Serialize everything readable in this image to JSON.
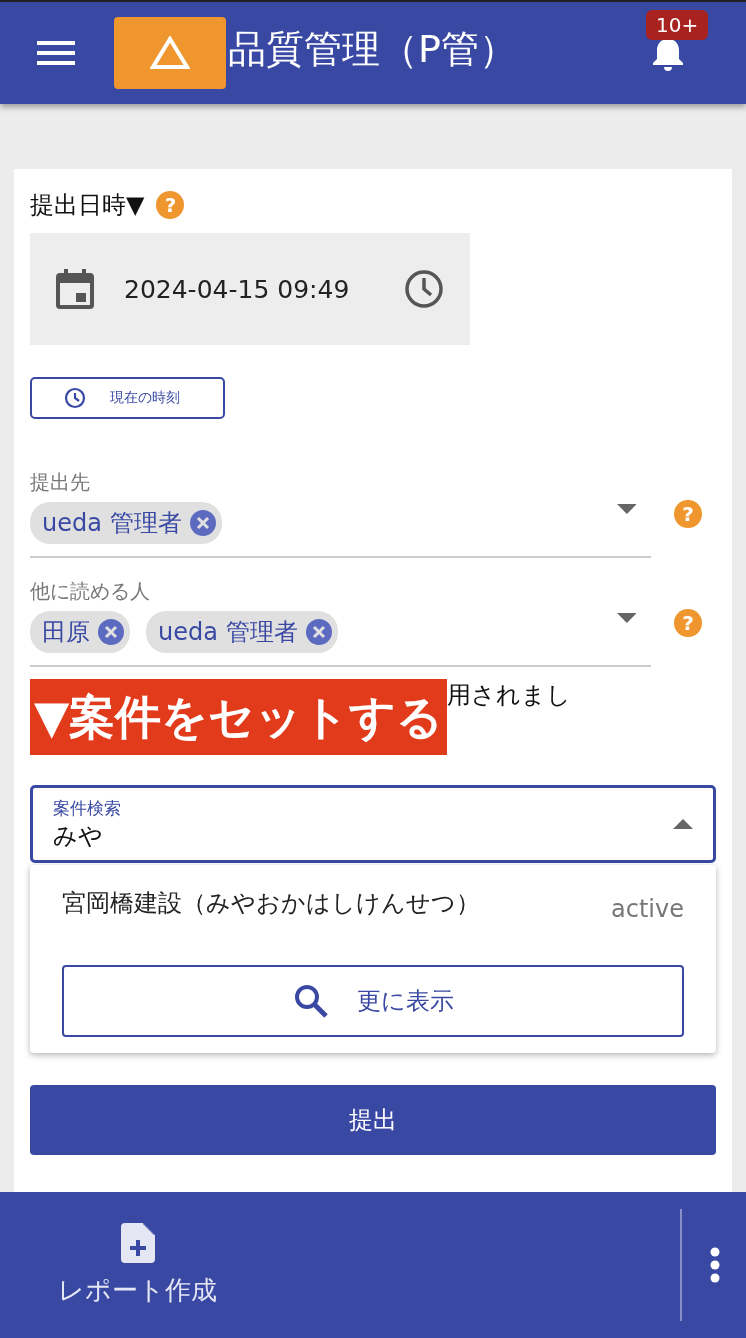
{
  "header": {
    "title": "品質管理（P管）",
    "badge": "10+"
  },
  "submit_time": {
    "label": "提出日時▼",
    "help": "?",
    "value": "2024-04-15 09:49",
    "now_button": "現在の時刻"
  },
  "recipients": {
    "label": "提出先",
    "help": "?",
    "chips": [
      "ueda 管理者"
    ]
  },
  "readers": {
    "label": "他に読める人",
    "help": "?",
    "chips": [
      "田原",
      "ueda 管理者"
    ]
  },
  "note": "用されまし",
  "banner": "▼案件をセットする",
  "case_search": {
    "label": "案件検索",
    "value": "みや",
    "expanded": true
  },
  "results": [
    {
      "name": "宮岡橋建設（みやおかはしけんせつ）",
      "status": "active"
    }
  ],
  "more_button": "更に表示",
  "submit_button": "提出",
  "bottom_bar": {
    "action": "レポート作成"
  }
}
